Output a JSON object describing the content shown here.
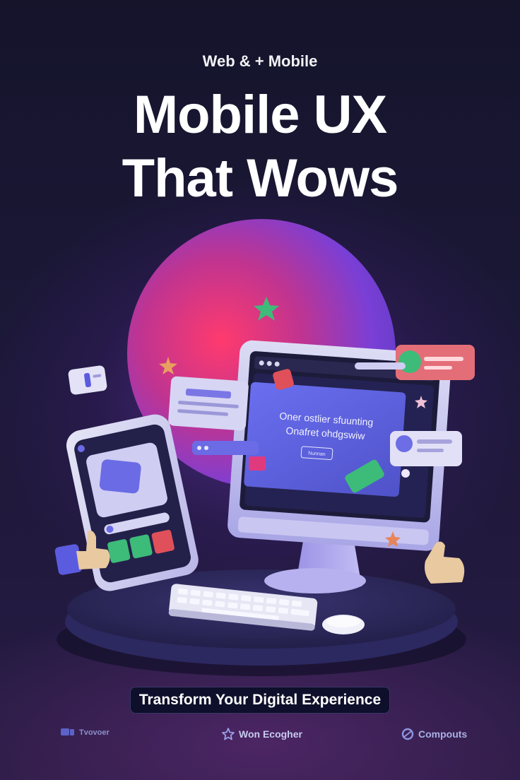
{
  "eyebrow": "Web & + Mobile",
  "headline": {
    "line1": "Mobile UX",
    "line2": "That Wows"
  },
  "monitor_screen": {
    "line1": "Oner ostlier sfuunting",
    "line2": "Onafret ohdgswiw",
    "button": "Nunnan"
  },
  "tagline": "Transform Your Digital Experience",
  "footer_logos": [
    {
      "label": "Tvovoer",
      "icon": "chat-bubble-icon"
    },
    {
      "label": "Won Ecogher",
      "icon": "star-outline-icon"
    },
    {
      "label": "Compouts",
      "icon": "c-circle-icon"
    }
  ],
  "colors": {
    "background": "#15142b",
    "orb_pink": "#e0306c",
    "orb_purple": "#7a3fd6",
    "screen_blue": "#5a5fe0",
    "accent_green": "#3dbb78",
    "accent_red": "#e0505a",
    "thumb_skin": "#e8c9a0"
  }
}
